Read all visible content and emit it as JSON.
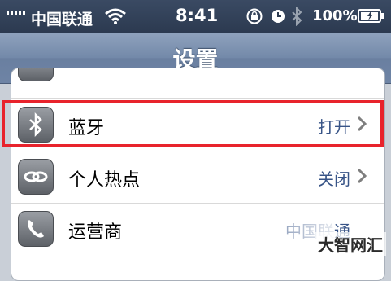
{
  "status_bar": {
    "carrier": "中国联通",
    "time": "8:41",
    "battery": "100%"
  },
  "nav": {
    "title": "设置"
  },
  "rows": [
    {
      "label": "蓝牙",
      "value": "打开",
      "icon": "bluetooth-icon"
    },
    {
      "label": "个人热点",
      "value": "关闭",
      "icon": "link-icon"
    },
    {
      "label": "运营商",
      "value": "中国联通",
      "icon": "phone-icon"
    }
  ],
  "watermark": "大智网汇",
  "colors": {
    "highlight": "#e8232c",
    "value_text": "#385487",
    "nav": "#7389a9"
  }
}
